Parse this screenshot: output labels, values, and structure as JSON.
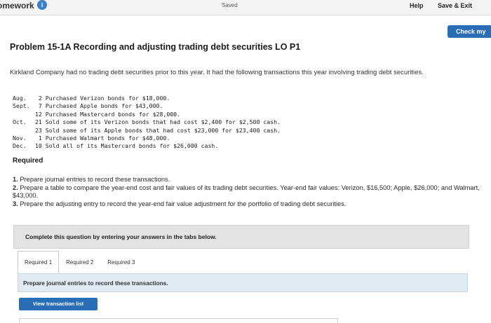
{
  "header": {
    "app_title": "omework",
    "info_icon": "i",
    "saved_status": "Saved",
    "help": "Help",
    "save_exit": "Save & Exit"
  },
  "check_button": "Check my",
  "problem": {
    "title": "Problem 15-1A Recording and adjusting trading debt securities LO P1",
    "intro": "Kirkland Company had no trading debt securities prior to this year. It had the following transactions this year involving trading debt securities."
  },
  "transactions": [
    {
      "month": "Aug.",
      "text": " 2 Purchased Verizon bonds for $18,000."
    },
    {
      "month": "Sept.",
      "text": " 7 Purchased Apple bonds for $43,000."
    },
    {
      "month": "",
      "text": "12 Purchased Mastercard bonds for $28,000."
    },
    {
      "month": "Oct.",
      "text": "21 Sold some of its Verizon bonds that had cost $2,400 for $2,500 cash."
    },
    {
      "month": "",
      "text": "23 Sold some of its Apple bonds that had cost $23,000 for $23,400 cash."
    },
    {
      "month": "Nov.",
      "text": " 1 Purchased Walmart bonds for $48,000."
    },
    {
      "month": "Dec.",
      "text": "10 Sold all of its Mastercard bonds for $26,000 cash."
    }
  ],
  "required": {
    "heading": "Required",
    "items": [
      {
        "num": "1.",
        "text": " Prepare journal entries to record these transactions."
      },
      {
        "num": "2.",
        "text": " Prepare a table to compare the year-end cost and fair values of its trading debt securities. Year-end fair values: Verizon, $16,500; Apple, $26,000; and Walmart, $43,000."
      },
      {
        "num": "3.",
        "text": " Prepare the adjusting entry to record the year-end fair value adjustment for the portfolio of trading debt securities."
      }
    ]
  },
  "instruction": "Complete this question by entering your answers in the tabs below.",
  "tabs": [
    "Required 1",
    "Required 2",
    "Required 3"
  ],
  "active_tab_text": "Prepare journal entries to record these transactions.",
  "view_button": "View transaction list"
}
